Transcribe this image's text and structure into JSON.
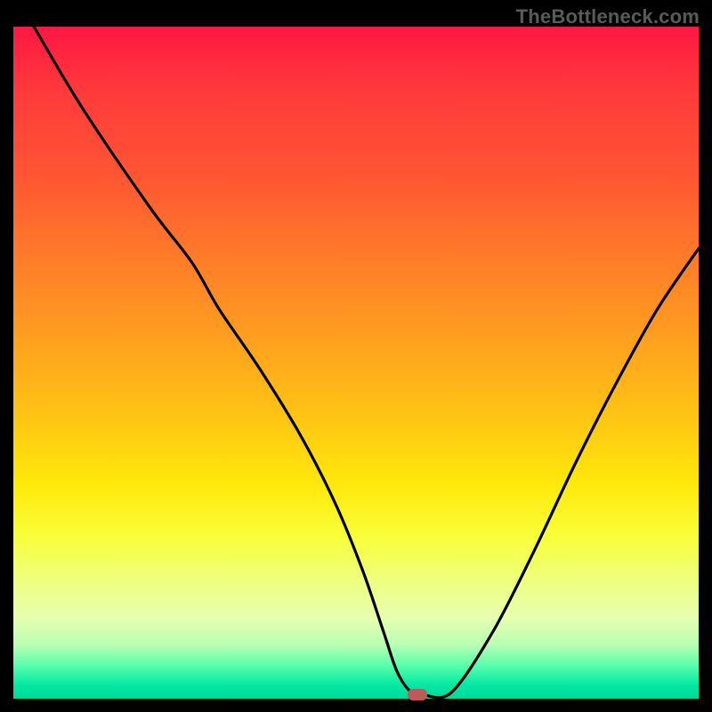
{
  "watermark": "TheBottleneck.com",
  "chart_data": {
    "type": "line",
    "title": "",
    "xlabel": "",
    "ylabel": "",
    "ylim": [
      0,
      100
    ],
    "xlim": [
      0,
      100
    ],
    "series": [
      {
        "name": "curve",
        "x": [
          3,
          10,
          20,
          26,
          30,
          36,
          42,
          47,
          51,
          54,
          56,
          58,
          60,
          64,
          70,
          76,
          82,
          88,
          94,
          100
        ],
        "y": [
          100,
          88,
          73,
          65,
          58,
          49,
          39,
          29,
          19,
          10,
          4,
          1,
          0.5,
          1,
          10,
          22,
          35,
          47,
          58,
          67
        ]
      }
    ],
    "marker": {
      "x": 59,
      "y": 0.5,
      "label": ""
    }
  },
  "colors": {
    "curve": "#000000",
    "background_top": "#ff1744",
    "background_bottom": "#00d99b",
    "marker": "#bf5a5a",
    "frame": "#000000"
  }
}
